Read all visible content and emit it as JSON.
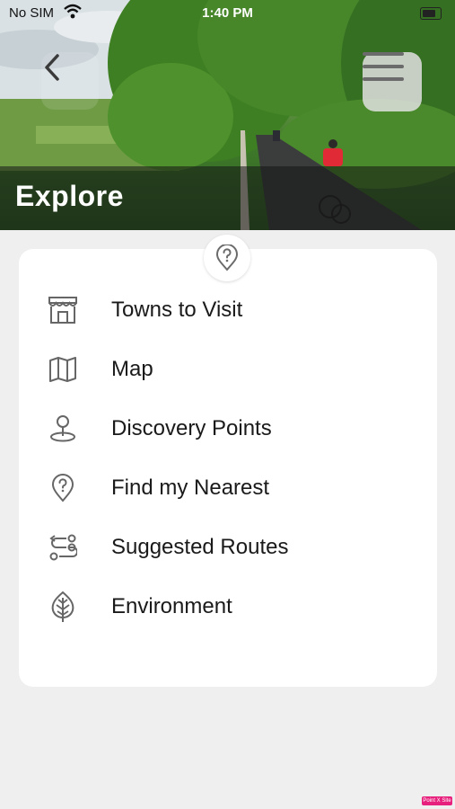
{
  "status_bar": {
    "carrier": "No SIM",
    "time": "1:40 PM"
  },
  "header": {
    "title": "Explore"
  },
  "menu": {
    "items": [
      {
        "label": "Towns to Visit",
        "icon": "storefront-icon"
      },
      {
        "label": "Map",
        "icon": "map-icon"
      },
      {
        "label": "Discovery Points",
        "icon": "location-pin-icon"
      },
      {
        "label": "Find my Nearest",
        "icon": "question-pin-icon"
      },
      {
        "label": "Suggested Routes",
        "icon": "route-icon"
      },
      {
        "label": "Environment",
        "icon": "leaf-icon"
      }
    ]
  },
  "badge": {
    "text": "Point X Site"
  },
  "colors": {
    "accent_badge": "#e8207d",
    "background": "#efefef",
    "card": "#ffffff",
    "icon": "#666666"
  }
}
